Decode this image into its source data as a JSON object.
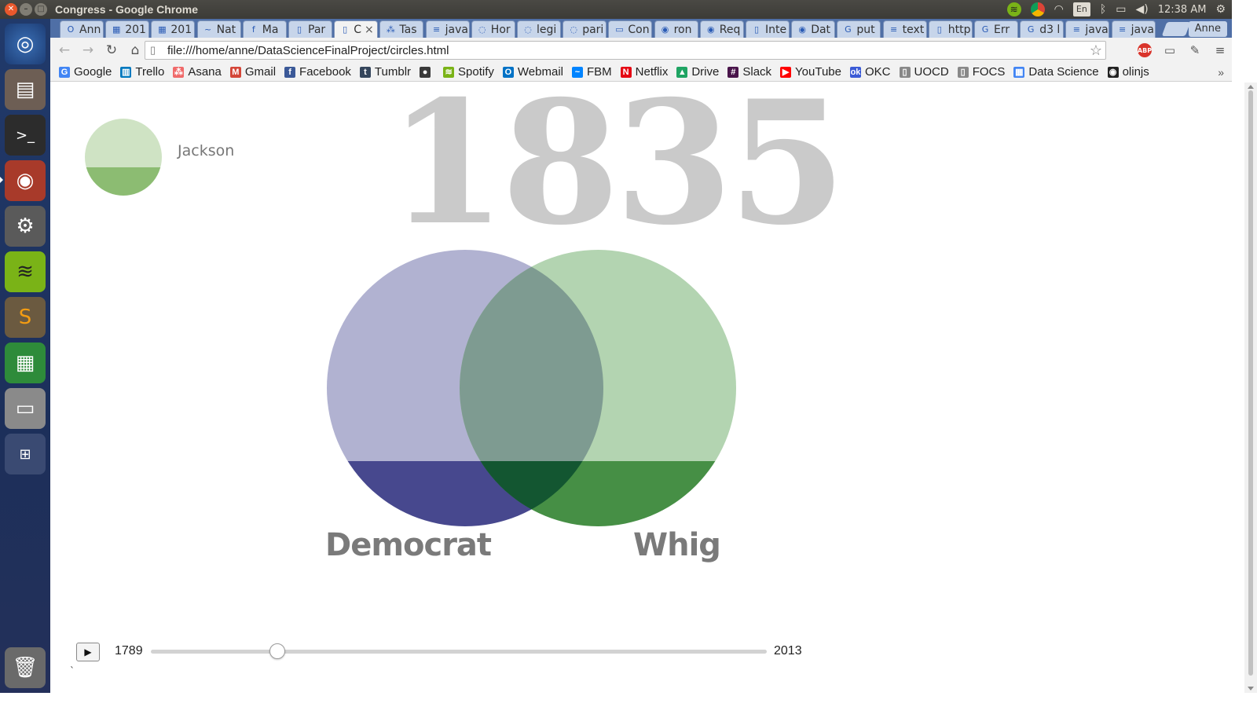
{
  "window": {
    "title": "Congress - Google Chrome",
    "close_glyph": "✕",
    "min_glyph": "–",
    "max_glyph": "□"
  },
  "system_tray": {
    "keyboard_layout": "En",
    "clock": "12:38 AM",
    "icons": [
      "spotify-icon",
      "chrome-icon",
      "wifi-icon",
      "keyboard-icon",
      "bluetooth-icon",
      "battery-icon",
      "volume-icon",
      "settings-gear-icon"
    ]
  },
  "tabs": [
    {
      "label": "Ann",
      "icon": "outlook-icon"
    },
    {
      "label": "201",
      "icon": "sheets-icon"
    },
    {
      "label": "201",
      "icon": "sheets-icon"
    },
    {
      "label": "Nat",
      "icon": "messenger-icon"
    },
    {
      "label": "Ma",
      "icon": "facebook-icon"
    },
    {
      "label": "Par",
      "icon": "page-icon"
    },
    {
      "label": "C",
      "icon": "page-icon",
      "active": true
    },
    {
      "label": "Tas",
      "icon": "asana-icon"
    },
    {
      "label": "java",
      "icon": "stackoverflow-icon"
    },
    {
      "label": "Hor",
      "icon": "loading-icon"
    },
    {
      "label": "legi",
      "icon": "loading-icon"
    },
    {
      "label": "pari",
      "icon": "loading-icon"
    },
    {
      "label": "Con",
      "icon": "slides-icon"
    },
    {
      "label": "ron",
      "icon": "github-icon"
    },
    {
      "label": "Req",
      "icon": "github-icon"
    },
    {
      "label": "Inte",
      "icon": "page-icon"
    },
    {
      "label": "Dat",
      "icon": "github-icon"
    },
    {
      "label": "put",
      "icon": "google-icon"
    },
    {
      "label": "text",
      "icon": "stackoverflow-icon"
    },
    {
      "label": "http",
      "icon": "page-icon"
    },
    {
      "label": "Err",
      "icon": "google-icon"
    },
    {
      "label": "d3 l",
      "icon": "google-icon"
    },
    {
      "label": "java",
      "icon": "stackoverflow-icon"
    },
    {
      "label": "java",
      "icon": "stackoverflow-icon"
    }
  ],
  "profile_name": "Anne",
  "toolbar": {
    "url": "file:///home/anne/DataScienceFinalProject/circles.html",
    "abp_label": "ABP"
  },
  "bookmarks": [
    {
      "label": "Google",
      "icon": "google-icon",
      "color": "#4285f4",
      "glyph": "G"
    },
    {
      "label": "Trello",
      "icon": "trello-icon",
      "color": "#0079bf",
      "glyph": "▥"
    },
    {
      "label": "Asana",
      "icon": "asana-icon",
      "color": "#f06a6a",
      "glyph": "⁂"
    },
    {
      "label": "Gmail",
      "icon": "gmail-icon",
      "color": "#d44638",
      "glyph": "M"
    },
    {
      "label": "Facebook",
      "icon": "facebook-icon",
      "color": "#3b5998",
      "glyph": "f"
    },
    {
      "label": "Tumblr",
      "icon": "tumblr-icon",
      "color": "#35465c",
      "glyph": "t"
    },
    {
      "label": "",
      "icon": "app-icon",
      "color": "#3a3a3a",
      "glyph": "●"
    },
    {
      "label": "Spotify",
      "icon": "spotify-icon",
      "color": "#7ab317",
      "glyph": "≋"
    },
    {
      "label": "Webmail",
      "icon": "outlook-icon",
      "color": "#0072c6",
      "glyph": "O"
    },
    {
      "label": "FBM",
      "icon": "messenger-icon",
      "color": "#0084ff",
      "glyph": "~"
    },
    {
      "label": "Netflix",
      "icon": "netflix-icon",
      "color": "#e50914",
      "glyph": "N"
    },
    {
      "label": "Drive",
      "icon": "drive-icon",
      "color": "#1fa463",
      "glyph": "▲"
    },
    {
      "label": "Slack",
      "icon": "slack-icon",
      "color": "#4a154b",
      "glyph": "#"
    },
    {
      "label": "YouTube",
      "icon": "youtube-icon",
      "color": "#ff0000",
      "glyph": "▶"
    },
    {
      "label": "OKC",
      "icon": "okcupid-icon",
      "color": "#3b5bd6",
      "glyph": "ok"
    },
    {
      "label": "UOCD",
      "icon": "page-icon",
      "color": "#888888",
      "glyph": "▯"
    },
    {
      "label": "FOCS",
      "icon": "page-icon",
      "color": "#888888",
      "glyph": "▯"
    },
    {
      "label": "Data Science",
      "icon": "calendar-icon",
      "color": "#4285f4",
      "glyph": "▦"
    },
    {
      "label": "olinjs",
      "icon": "github-icon",
      "color": "#222222",
      "glyph": "◉"
    }
  ],
  "visualization": {
    "year": "1835",
    "president": "Jackson",
    "legend_colors": {
      "light": "#cfe3c4",
      "dark": "#8cbc72"
    },
    "parties": [
      {
        "name": "Democrat",
        "light_color": "#b1b2d1",
        "dark_color": "#47488e"
      },
      {
        "name": "Whig",
        "light_color": "#b3d4b1",
        "dark_color": "#468f45"
      }
    ],
    "overlap_colors": {
      "light": "#7e9b91",
      "dark": "#135631"
    },
    "slider": {
      "min_year": "1789",
      "max_year": "2013",
      "value": 1835
    },
    "play_glyph": "▶",
    "stray_mark": "`"
  }
}
